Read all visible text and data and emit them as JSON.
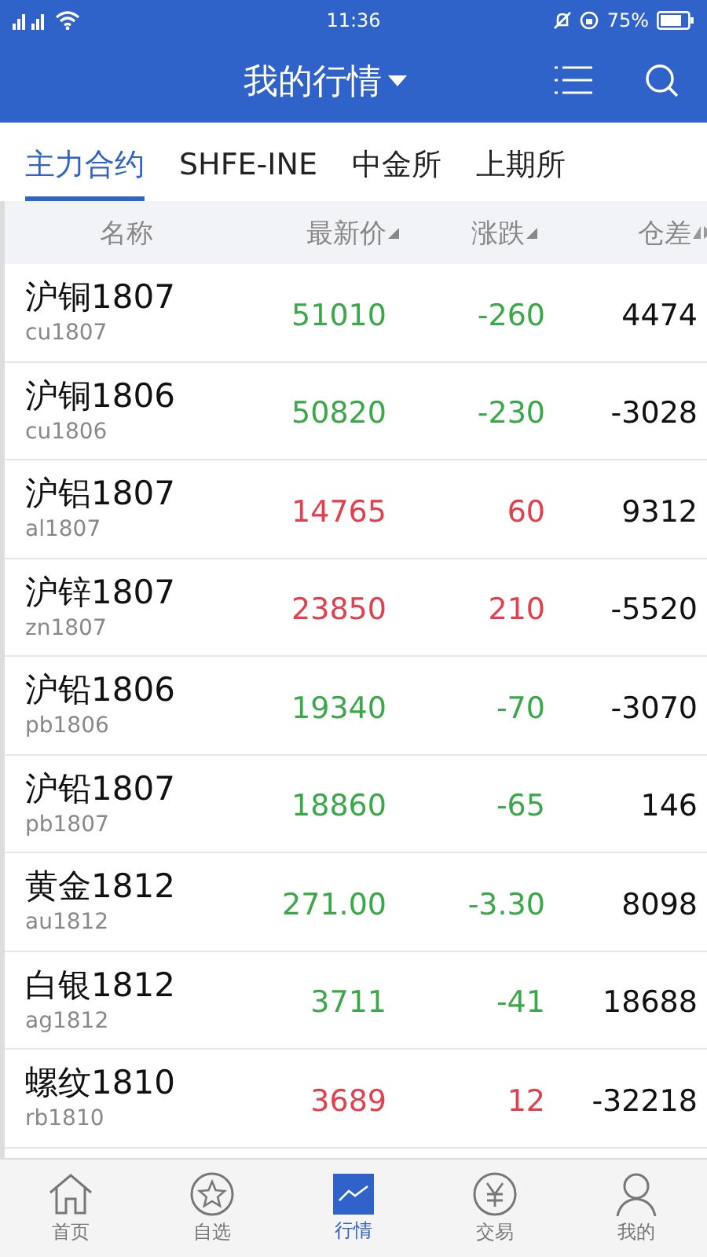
{
  "status_bar": {
    "time": "11:36",
    "battery": "75%"
  },
  "header": {
    "title": "我的行情"
  },
  "tabs": [
    {
      "label": "主力合约",
      "selected": true
    },
    {
      "label": "SHFE-INE",
      "selected": false
    },
    {
      "label": "中金所",
      "selected": false
    },
    {
      "label": "上期所",
      "selected": false
    }
  ],
  "table": {
    "columns": [
      "名称",
      "最新价",
      "涨跌",
      "仓差"
    ],
    "rows": [
      {
        "name": "沪铜1807",
        "code": "cu1807",
        "price": "51010",
        "change": "-260",
        "oi_change": "4474",
        "kind": "down"
      },
      {
        "name": "沪铜1806",
        "code": "cu1806",
        "price": "50820",
        "change": "-230",
        "oi_change": "-3028",
        "kind": "down"
      },
      {
        "name": "沪铝1807",
        "code": "al1807",
        "price": "14765",
        "change": "60",
        "oi_change": "9312",
        "kind": "up"
      },
      {
        "name": "沪锌1807",
        "code": "zn1807",
        "price": "23850",
        "change": "210",
        "oi_change": "-5520",
        "kind": "up"
      },
      {
        "name": "沪铅1806",
        "code": "pb1806",
        "price": "19340",
        "change": "-70",
        "oi_change": "-3070",
        "kind": "down"
      },
      {
        "name": "沪铅1807",
        "code": "pb1807",
        "price": "18860",
        "change": "-65",
        "oi_change": "146",
        "kind": "down"
      },
      {
        "name": "黄金1812",
        "code": "au1812",
        "price": "271.00",
        "change": "-3.30",
        "oi_change": "8098",
        "kind": "down"
      },
      {
        "name": "白银1812",
        "code": "ag1812",
        "price": "3711",
        "change": "-41",
        "oi_change": "18688",
        "kind": "down"
      },
      {
        "name": "螺纹1810",
        "code": "rb1810",
        "price": "3689",
        "change": "12",
        "oi_change": "-32218",
        "kind": "up"
      }
    ]
  },
  "nav": [
    {
      "label": "首页",
      "kind": "home",
      "selected": false
    },
    {
      "label": "自选",
      "kind": "star",
      "selected": false
    },
    {
      "label": "行情",
      "kind": "chart",
      "selected": true
    },
    {
      "label": "交易",
      "kind": "yen",
      "selected": false
    },
    {
      "label": "我的",
      "kind": "person",
      "selected": false
    }
  ]
}
